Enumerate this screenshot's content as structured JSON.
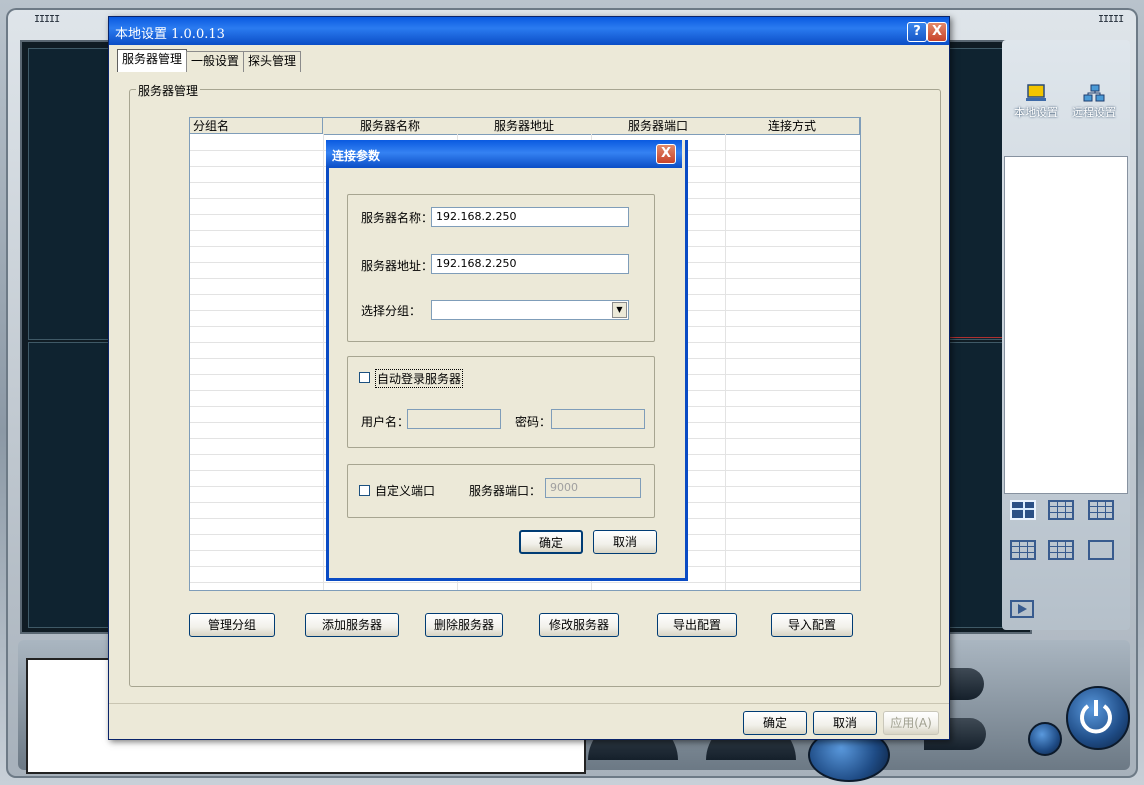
{
  "main_window": {
    "title": "本地设置 1.0.0.13",
    "help_button": "?",
    "close_button": "X",
    "tabs": [
      {
        "label": "服务器管理",
        "active": true
      },
      {
        "label": "一般设置",
        "active": false
      },
      {
        "label": "探头管理",
        "active": false
      }
    ],
    "group_label": "服务器管理",
    "table": {
      "columns": [
        "分组名",
        "服务器名称",
        "服务器地址",
        "服务器端口",
        "连接方式"
      ],
      "rows": []
    },
    "action_buttons": [
      "管理分组",
      "添加服务器",
      "删除服务器",
      "修改服务器",
      "导出配置",
      "导入配置"
    ],
    "footer_buttons": {
      "ok": "确定",
      "cancel": "取消",
      "apply": "应用(A)"
    }
  },
  "modal": {
    "title": "连接参数",
    "close_button": "X",
    "server_name_label": "服务器名称：",
    "server_name_value": "192.168.2.250",
    "server_address_label": "服务器地址：",
    "server_address_value": "192.168.2.250",
    "group_label": "选择分组：",
    "group_value": "",
    "auto_login_label": "自动登录服务器",
    "auto_login_checked": false,
    "username_label": "用户名：",
    "username_value": "",
    "password_label": "密码：",
    "password_value": "",
    "custom_port_label": "自定义端口",
    "custom_port_checked": false,
    "server_port_label": "服务器端口：",
    "server_port_value": "9000",
    "ok_button": "确定",
    "cancel_button": "取消"
  },
  "background_app": {
    "local_settings_label": "本地设置",
    "remote_settings_label": "远程设置",
    "grip_left": "IIIII",
    "grip_right": "IIIII"
  },
  "colors": {
    "title_bar": "#0a5ae0",
    "dialog_bg": "#ece9d8",
    "close_red": "#c8432a"
  }
}
